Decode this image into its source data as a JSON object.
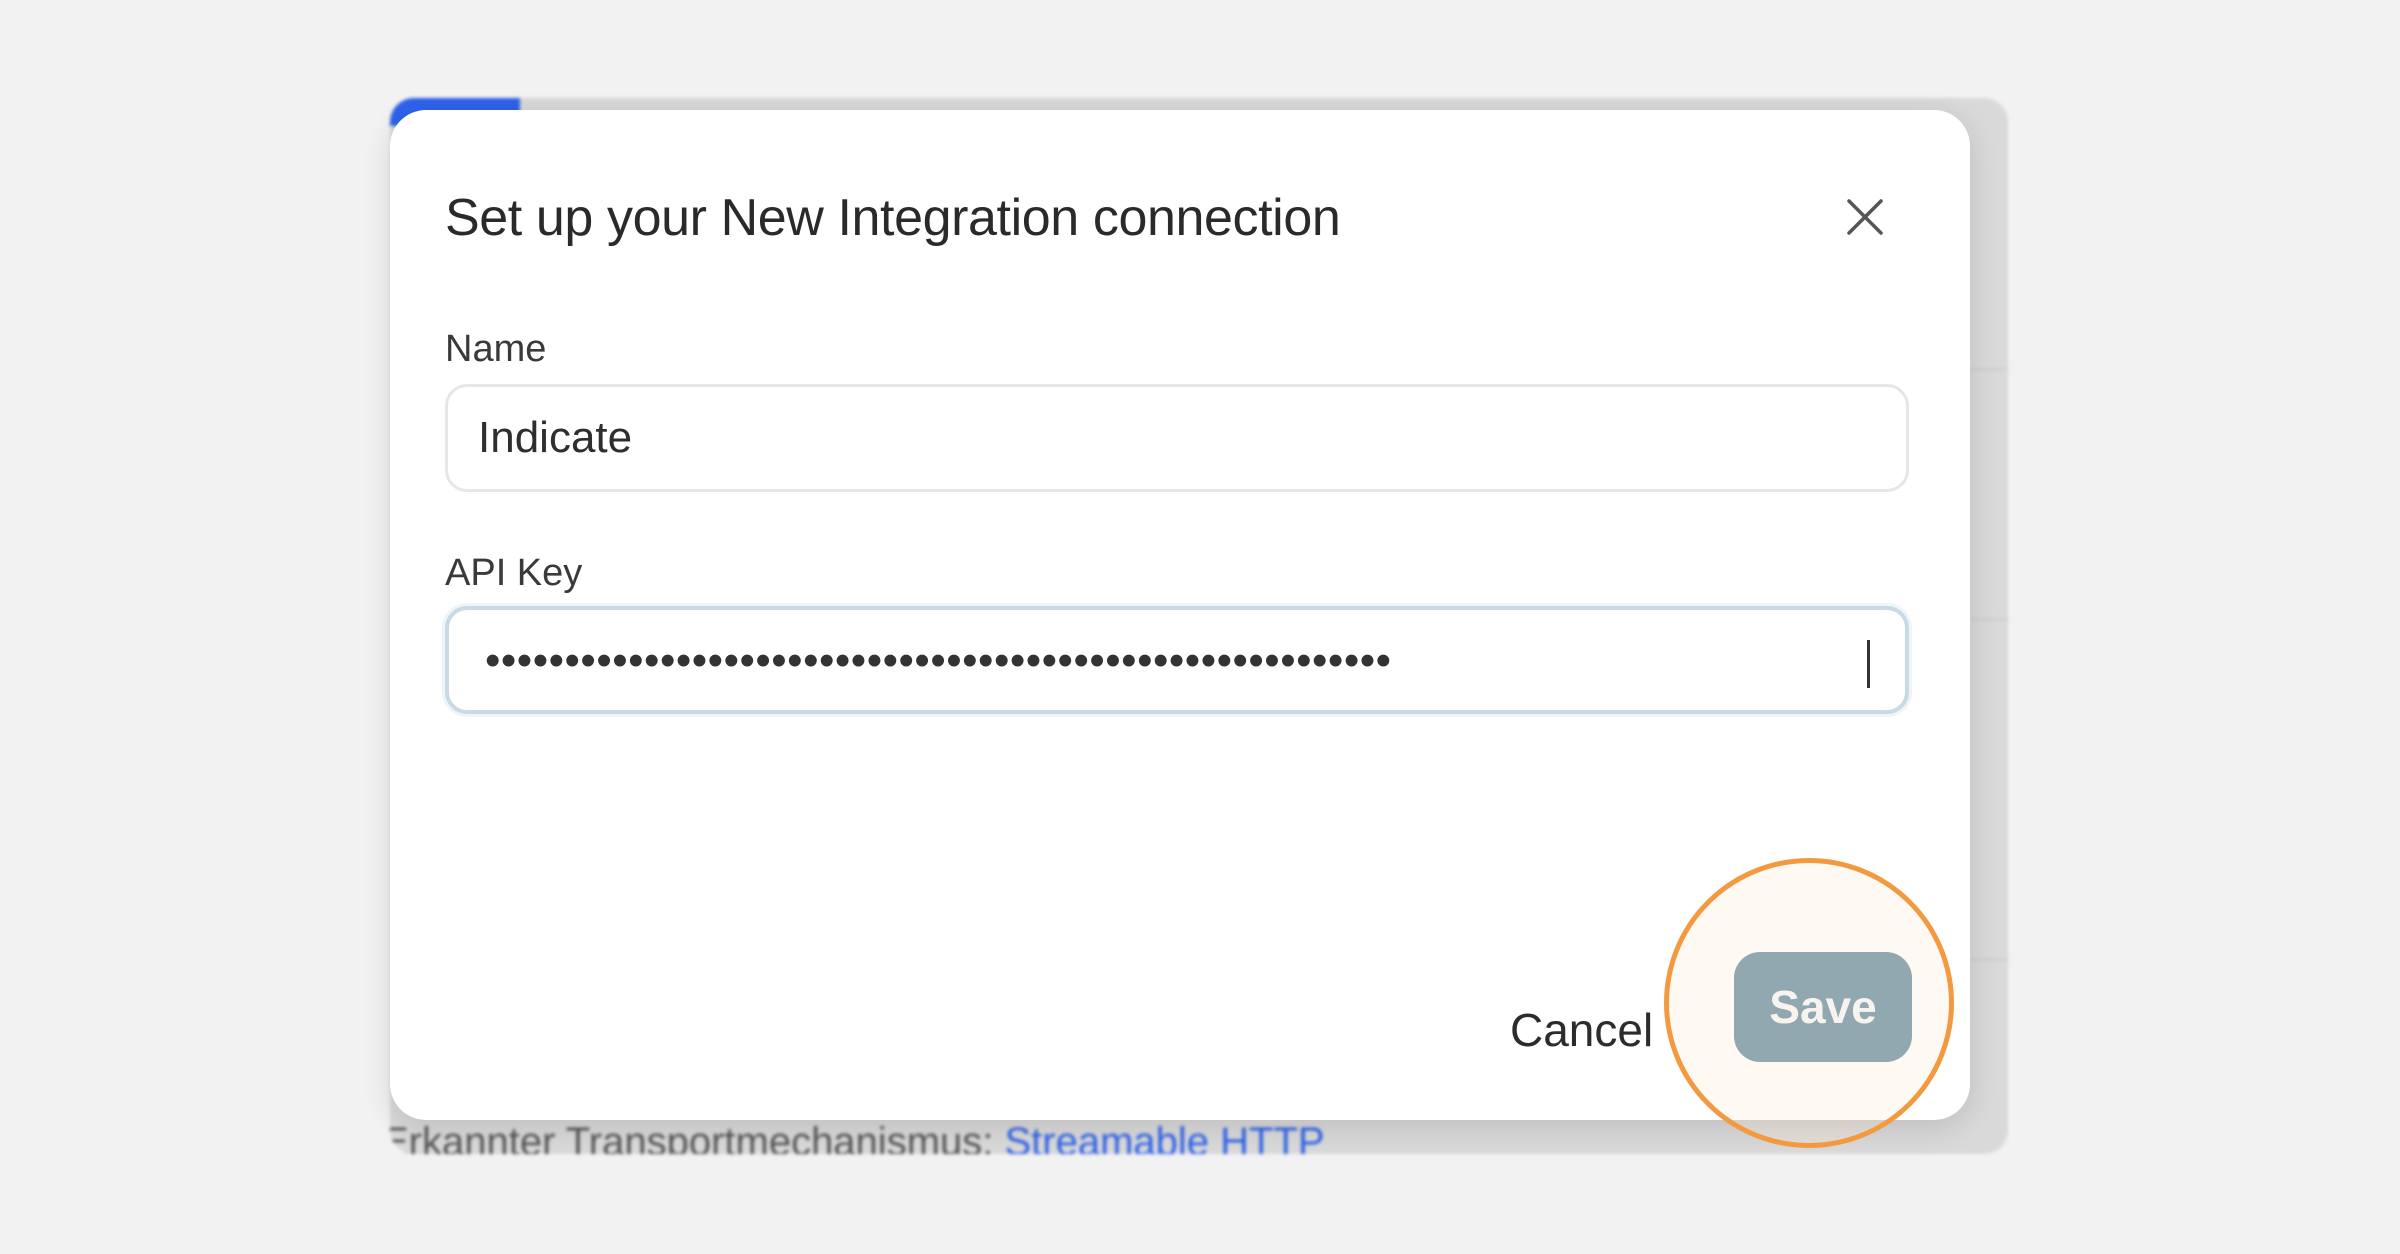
{
  "background": {
    "bottom_text": "Erkannter Transportmechanismus:",
    "bottom_link": "Streamable HTTP",
    "accent_color": "#2f62ea"
  },
  "modal": {
    "title": "Set up your New Integration connection",
    "close_icon": "close-icon",
    "fields": {
      "name": {
        "label": "Name",
        "value": "Indicate"
      },
      "api_key": {
        "label": "API Key",
        "masked_value": "•••••••••••••••••••••••••••••••••••••••••••••••••••••••••"
      }
    },
    "actions": {
      "cancel_label": "Cancel",
      "save_label": "Save",
      "save_color": "#6d93a5"
    }
  },
  "highlight": {
    "target": "save-button",
    "color": "#f39a40"
  }
}
